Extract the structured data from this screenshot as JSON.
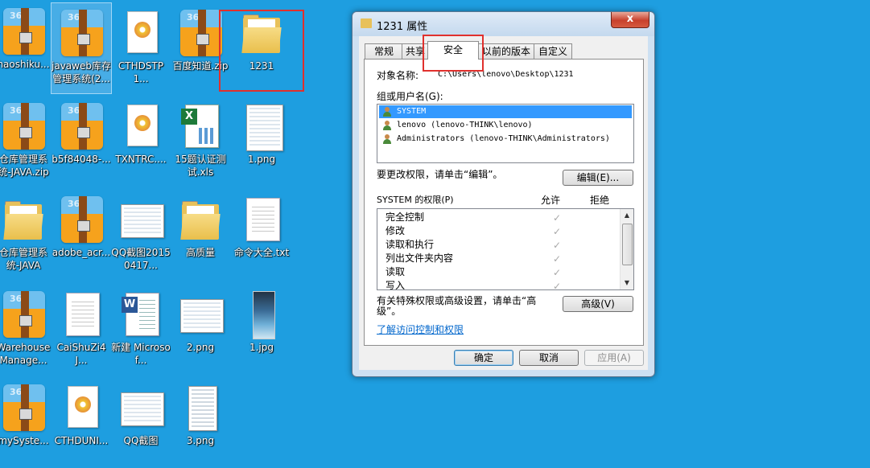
{
  "desktop": {
    "icons": [
      {
        "label": "haoshiku...",
        "type": "zip"
      },
      {
        "label": "javaweb库存管理系统(2...",
        "type": "zip"
      },
      {
        "label": "CTHDSTP1...",
        "type": "setup"
      },
      {
        "label": "百度知道.zip",
        "type": "zip"
      },
      {
        "label": "1231",
        "type": "folder"
      },
      {
        "label": "仓库管理系统-JAVA.zip",
        "type": "zip"
      },
      {
        "label": "b5f84048-...",
        "type": "zip"
      },
      {
        "label": "TXNTRC....",
        "type": "setup"
      },
      {
        "label": "15题认证测试.xls",
        "type": "xls"
      },
      {
        "label": "1.png",
        "type": "shot"
      },
      {
        "label": "仓库管理系统-JAVA",
        "type": "folder"
      },
      {
        "label": "adobe_acr...",
        "type": "zip"
      },
      {
        "label": "QQ截图20150417...",
        "type": "shot"
      },
      {
        "label": "高质量",
        "type": "folder"
      },
      {
        "label": "命令大全.txt",
        "type": "doc"
      },
      {
        "label": "Warehouse Manage...",
        "type": "zip"
      },
      {
        "label": "CaiShuZi4J...",
        "type": "doc"
      },
      {
        "label": "新建 Microsof...",
        "type": "word"
      },
      {
        "label": "2.png",
        "type": "shot"
      },
      {
        "label": "1.jpg",
        "type": "jpg"
      },
      {
        "label": "mySyste...",
        "type": "zip"
      },
      {
        "label": "CTHDUNI...",
        "type": "setup"
      },
      {
        "label": "QQ截图",
        "type": "shot"
      },
      {
        "label": "3.png",
        "type": "shot"
      }
    ]
  },
  "dialog": {
    "title": "1231 属性",
    "close_label": "x",
    "tabs": [
      "常规",
      "共享",
      "安全",
      "以前的版本",
      "自定义"
    ],
    "active_tab": "安全",
    "object_name_label": "对象名称:",
    "object_name_value": "C:\\Users\\lenovo\\Desktop\\1231",
    "groups_label": "组或用户名(G):",
    "groups": [
      "SYSTEM",
      "lenovo (lenovo-THINK\\lenovo)",
      "Administrators (lenovo-THINK\\Administrators)"
    ],
    "change_perm_text": "要更改权限，请单击“编辑”。",
    "edit_button": "编辑(E)...",
    "perm_header": "SYSTEM 的权限(P)",
    "allow_header": "允许",
    "deny_header": "拒绝",
    "permissions": [
      {
        "name": "完全控制",
        "allow": true
      },
      {
        "name": "修改",
        "allow": true
      },
      {
        "name": "读取和执行",
        "allow": true
      },
      {
        "name": "列出文件夹内容",
        "allow": true
      },
      {
        "name": "读取",
        "allow": true
      },
      {
        "name": "写入",
        "allow": true
      }
    ],
    "advanced_text_line1": "有关特殊权限或高级设置，请单击“高",
    "advanced_text_line2": "级”。",
    "advanced_button": "高级(V)",
    "learn_link": "了解访问控制和权限",
    "ok_button": "确定",
    "cancel_button": "取消",
    "apply_button": "应用(A)"
  },
  "colors": {
    "desktop_bg": "#1e9ee0",
    "highlight_red": "#e0302d",
    "selection_blue": "#3399ff",
    "link_blue": "#0066cc"
  }
}
